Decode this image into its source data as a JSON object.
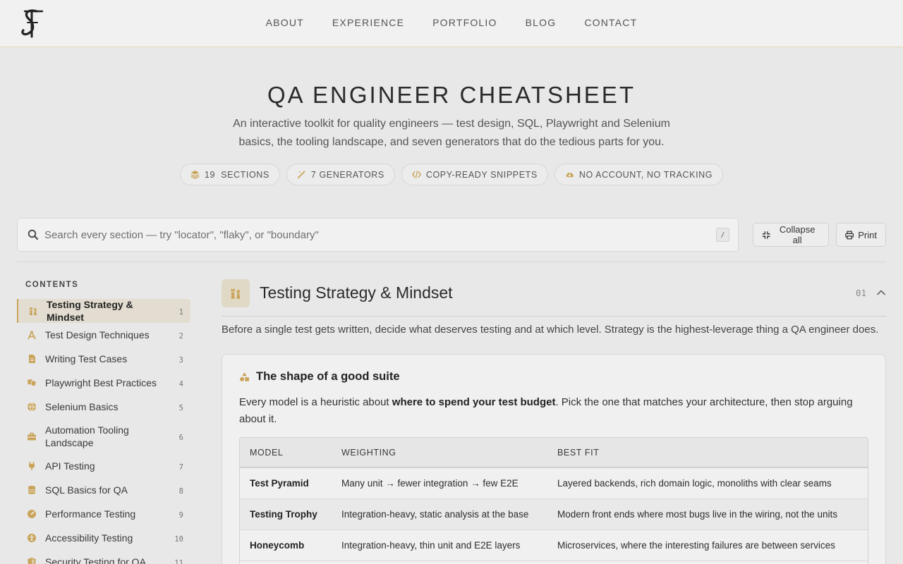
{
  "nav": {
    "logo": "SF monogram logo",
    "links": [
      "ABOUT",
      "EXPERIENCE",
      "PORTFOLIO",
      "BLOG",
      "CONTACT"
    ]
  },
  "hero": {
    "title": "QA ENGINEER CHEATSHEET",
    "subtitle": "An interactive toolkit for quality engineers — test design, SQL, Playwright and Selenium basics, the tooling landscape, and seven generators that do the tedious parts for you.",
    "pills": [
      {
        "icon": "layers-icon",
        "label": "19  SECTIONS"
      },
      {
        "icon": "magic-wand-icon",
        "label": "7 GENERATORS"
      },
      {
        "icon": "code-icon",
        "label": "COPY-READY SNIPPETS"
      },
      {
        "icon": "cloud-icon",
        "label": "NO ACCOUNT, NO TRACKING"
      }
    ]
  },
  "search": {
    "placeholder": "Search every section — try \"locator\", \"flaky\", or \"boundary\"",
    "shortcut": "/"
  },
  "toolbar": {
    "collapse_label": "Collapse all",
    "print_label": "Print"
  },
  "sidebar": {
    "heading": "CONTENTS",
    "items": [
      {
        "icon": "chess-icon",
        "label": "Testing Strategy & Mindset",
        "num": "1",
        "active": true
      },
      {
        "icon": "compass-icon",
        "label": "Test Design Techniques",
        "num": "2"
      },
      {
        "icon": "document-icon",
        "label": "Writing Test Cases",
        "num": "3"
      },
      {
        "icon": "masks-icon",
        "label": "Playwright Best Practices",
        "num": "4"
      },
      {
        "icon": "globe-icon",
        "label": "Selenium Basics",
        "num": "5"
      },
      {
        "icon": "toolbox-icon",
        "label": "Automation Tooling Landscape",
        "num": "6"
      },
      {
        "icon": "plug-icon",
        "label": "API Testing",
        "num": "7"
      },
      {
        "icon": "database-icon",
        "label": "SQL Basics for QA",
        "num": "8"
      },
      {
        "icon": "gauge-icon",
        "label": "Performance Testing",
        "num": "9"
      },
      {
        "icon": "accessibility-icon",
        "label": "Accessibility Testing",
        "num": "10"
      },
      {
        "icon": "shield-icon",
        "label": "Security Testing for QA",
        "num": "11"
      }
    ]
  },
  "section": {
    "title": "Testing Strategy & Mindset",
    "number": "01",
    "intro": "Before a single test gets written, decide what deserves testing and at which level. Strategy is the highest-leverage thing a QA engineer does.",
    "card": {
      "title": "The shape of a good suite",
      "text_before": "Every model is a heuristic about ",
      "text_bold": "where to spend your test budget",
      "text_after": ". Pick the one that matches your architecture, then stop arguing about it.",
      "table": {
        "headers": [
          "MODEL",
          "WEIGHTING",
          "BEST FIT"
        ],
        "rows": [
          [
            "Test Pyramid",
            "Many unit → fewer integration → few E2E",
            "Layered backends, rich domain logic, monoliths with clear seams"
          ],
          [
            "Testing Trophy",
            "Integration-heavy, static analysis at the base",
            "Modern front ends where most bugs live in the wiring, not the units"
          ],
          [
            "Honeycomb",
            "Integration-heavy, thin unit and E2E layers",
            "Microservices, where the interesting failures are between services"
          ]
        ]
      }
    }
  },
  "colors": {
    "accent": "#c9a45a",
    "background": "#e8e8e8",
    "header": "#f1f1f1"
  }
}
